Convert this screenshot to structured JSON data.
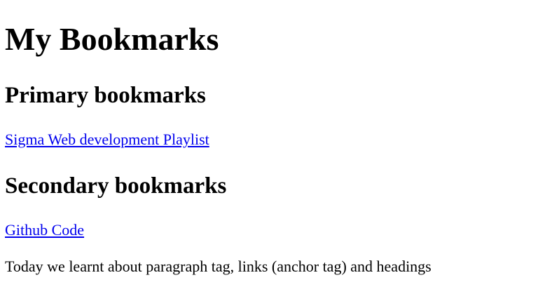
{
  "page": {
    "title": "My Bookmarks",
    "sections": [
      {
        "heading": "Primary bookmarks",
        "link_label": "Sigma Web development Playlist"
      },
      {
        "heading": "Secondary bookmarks",
        "link_label": "Github Code"
      }
    ],
    "paragraph": "Today we learnt about paragraph tag, links (anchor tag) and headings"
  },
  "colors": {
    "link": "#0000ee",
    "text": "#000000",
    "background": "#ffffff"
  }
}
